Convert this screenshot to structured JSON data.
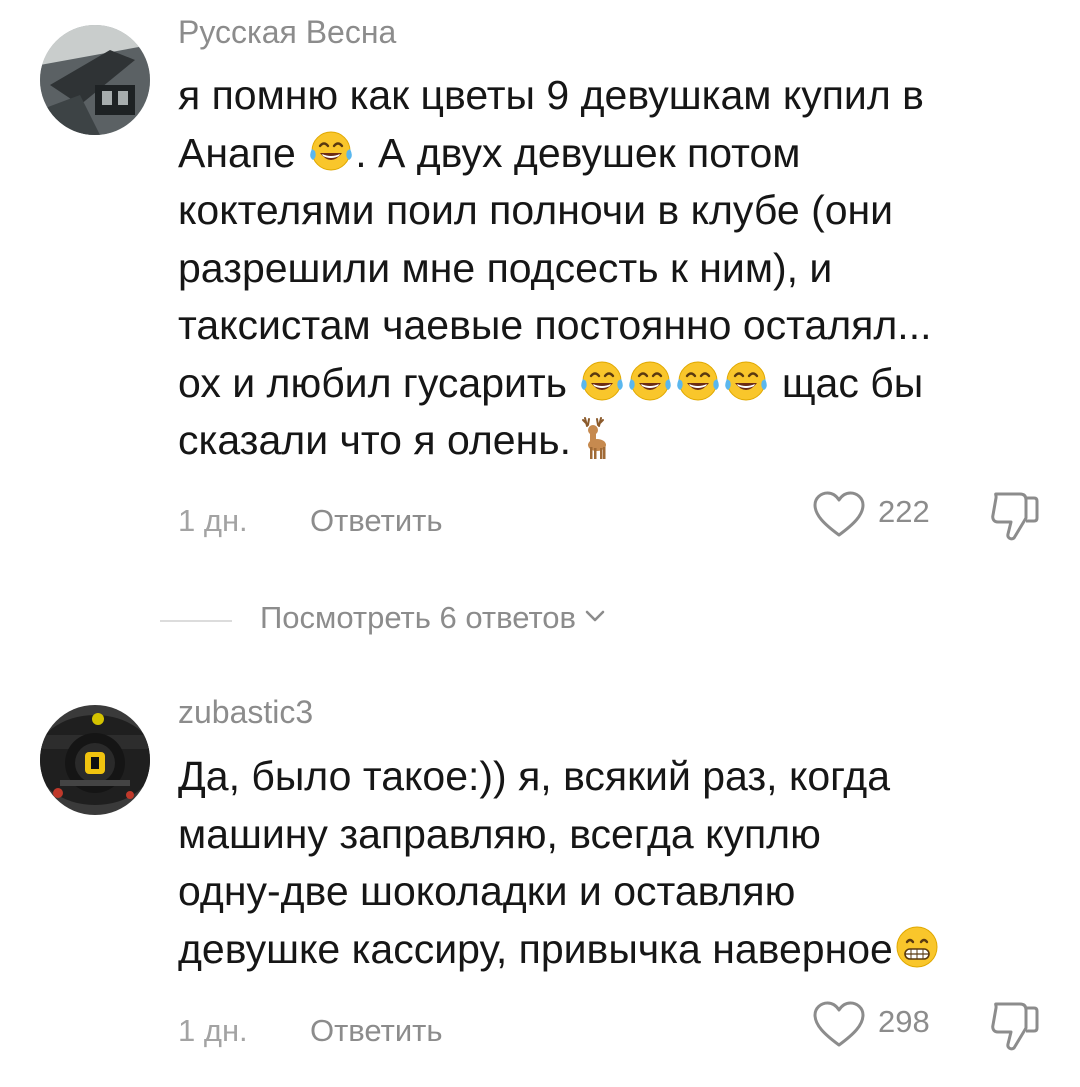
{
  "comments": [
    {
      "author": "Русская Весна",
      "lines": [
        [
          "я помню как цветы 9 девушкам купил в"
        ],
        [
          "Анапе ",
          "face-with-tears-of-joy-emoji",
          ". А двух девушек потом"
        ],
        [
          "коктелями поил полночи в клубе (они"
        ],
        [
          "разрешили мне подсесть к ним), и"
        ],
        [
          "таксистам чаевые постоянно осталял..."
        ],
        [
          "ох и любил гусарить ",
          "face-with-tears-of-joy-emoji",
          "face-with-tears-of-joy-emoji",
          "face-with-tears-of-joy-emoji",
          "face-with-tears-of-joy-emoji",
          " щас бы"
        ],
        [
          "сказали что я олень.",
          "deer-emoji"
        ]
      ],
      "time": "1 дн.",
      "reply_label": "Ответить",
      "likes": "222"
    },
    {
      "author": "zubastic3",
      "lines": [
        [
          "Да, было такое:)) я, всякий раз, когда"
        ],
        [
          "машину заправляю, всегда куплю"
        ],
        [
          "одну-две шоколадки и оставляю"
        ],
        [
          "девушке кассиру, привычка наверное",
          "grinning-face-emoji"
        ]
      ],
      "time": "1 дн.",
      "reply_label": "Ответить",
      "likes": "298"
    }
  ],
  "replies_toggle": {
    "label": "Посмотреть 6 ответов"
  },
  "colors": {
    "text": "#161616",
    "muted": "#8c8c8c",
    "divider": "#dcdcdc",
    "emoji_yellow": "#f9c62b"
  },
  "icons": {
    "like": "heart-outline-icon",
    "dislike": "thumbs-down-outline-icon",
    "expand": "chevron-down-icon"
  }
}
